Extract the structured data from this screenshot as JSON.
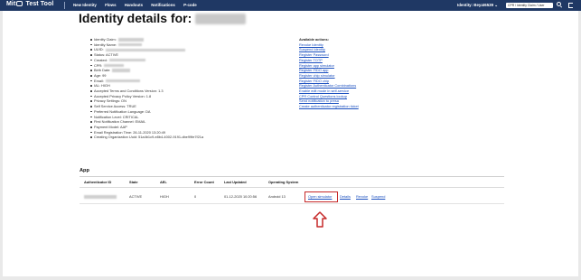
{
  "header": {
    "brand_left": "Mit",
    "brand_right": "Test Tool",
    "nav": [
      "New Identity",
      "Flows",
      "Handouts",
      "Notifications",
      "P-code"
    ],
    "identity_menu": "Identity: Beyat6539 ⌄",
    "search_text": "CPR / Identity Claim / User",
    "bar_color": "#1f3864"
  },
  "page": {
    "title": "Identity details for:"
  },
  "details": [
    "Identity Claim:",
    "Identity Name:",
    "UUID:",
    "Status: ACTIVE",
    "Created:",
    "CPR:",
    "Birth Date:",
    "Age: 99",
    "Email:",
    "IAL: HIGH",
    "Accepted Terms and Conditions Version: 1.3",
    "Accepted Privacy Policy Version: 1.8",
    "Privacy Settings: ON",
    "Self Service Access: TRUE",
    "Preferred Notification Language: DA",
    "Notification Level: CRITICAL",
    "First Notification Channel: EMAIL",
    "Payment Model: AAP",
    "Email Registration Time: 26-11-2020 13:20:49",
    "Creating Organization Uuid: 51a4b1c9-e8b4-4002-9191-dbe99fe7f21a"
  ],
  "actions": {
    "title": "Available actions:",
    "links": [
      "Revoke Identity",
      "Suspend Identity",
      "Register Password",
      "Register TOTP",
      "Register app simulator",
      "Register FIDO app",
      "Register chip simulator",
      "Register FIDO chip",
      "Register Authenticator Combinations",
      "Enable edit mode in self-service",
      "CPR Control Questions lookup",
      "Send notification to presa",
      "Create authenticator registration ticket"
    ]
  },
  "app": {
    "title": "App",
    "columns": [
      "Authenticator ID",
      "State",
      "AEL",
      "Error Count",
      "Last Updated",
      "Operating System"
    ],
    "row": {
      "state": "ACTIVE",
      "ael": "HIGH",
      "error_count": "0",
      "last_updated": "01-12-2020 10:20:56",
      "os": "Android 13",
      "actions": [
        "Open simulator",
        "Details",
        "Revoke",
        "Suspend"
      ]
    }
  },
  "colors": {
    "link": "#1a4fbf",
    "highlight": "#c62828"
  }
}
